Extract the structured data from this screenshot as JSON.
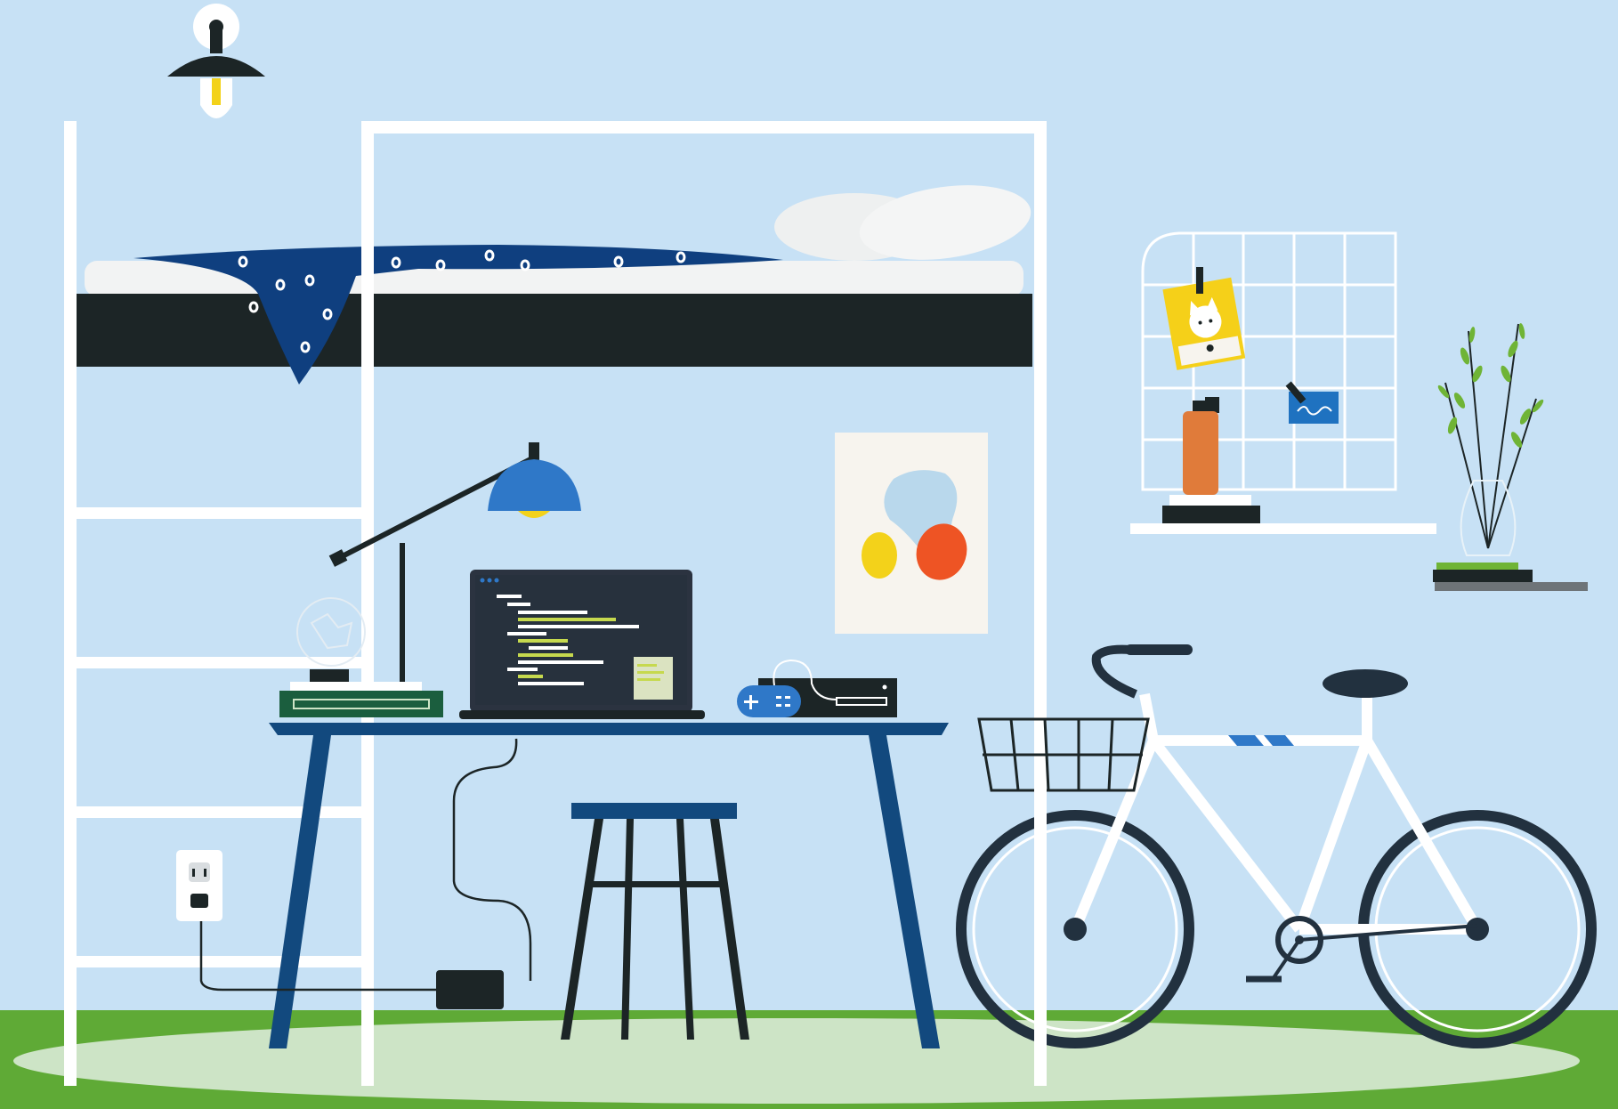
{
  "scene": {
    "label": "",
    "colors": {
      "wall": "#c7e1f5",
      "floor_green": "#5faa36",
      "rug": "#cde4c6",
      "frame_white": "#ffffff",
      "mattress": "#1c2526",
      "blanket": "#0f3f7f",
      "desk_blue": "#12497e",
      "lamp_shade": "#2f78c8",
      "laptop_dark": "#2b3340",
      "code_green": "#c6d94e",
      "poster_yellow": "#f3d21a",
      "poster_orange": "#ee5424",
      "bottle_orange": "#e07b3a",
      "note_yellow": "#f5d019",
      "plant_green": "#6fb436",
      "bike_dark": "#22313f"
    },
    "icons": {
      "wall_sconce": "wall-lamp-icon",
      "outlet": "power-outlet-icon",
      "game_controller": "game-controller-icon",
      "plant": "plant-vase-icon"
    }
  }
}
